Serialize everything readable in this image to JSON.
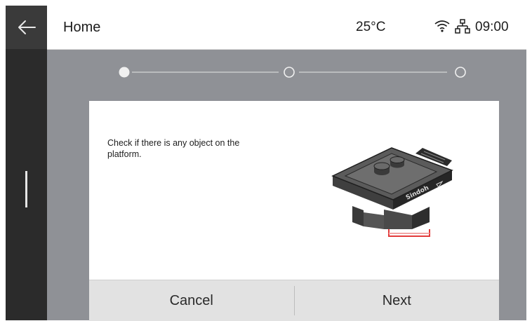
{
  "topbar": {
    "title": "Home",
    "temperature": "25°C",
    "time": "09:00",
    "icons": [
      "back-arrow-icon",
      "wifi-icon",
      "ethernet-icon"
    ]
  },
  "stepper": {
    "steps": 3,
    "current_step": 1
  },
  "dialog": {
    "message": "Check if there is any object on the platform.",
    "illustration_brand": "Sindoh",
    "cancel_label": "Cancel",
    "next_label": "Next"
  },
  "colors": {
    "sidebar": "#2b2b2b",
    "background": "#8f9196",
    "dialog": "#ffffff",
    "footer": "#e2e2e2",
    "highlight": "#e23a3a"
  }
}
